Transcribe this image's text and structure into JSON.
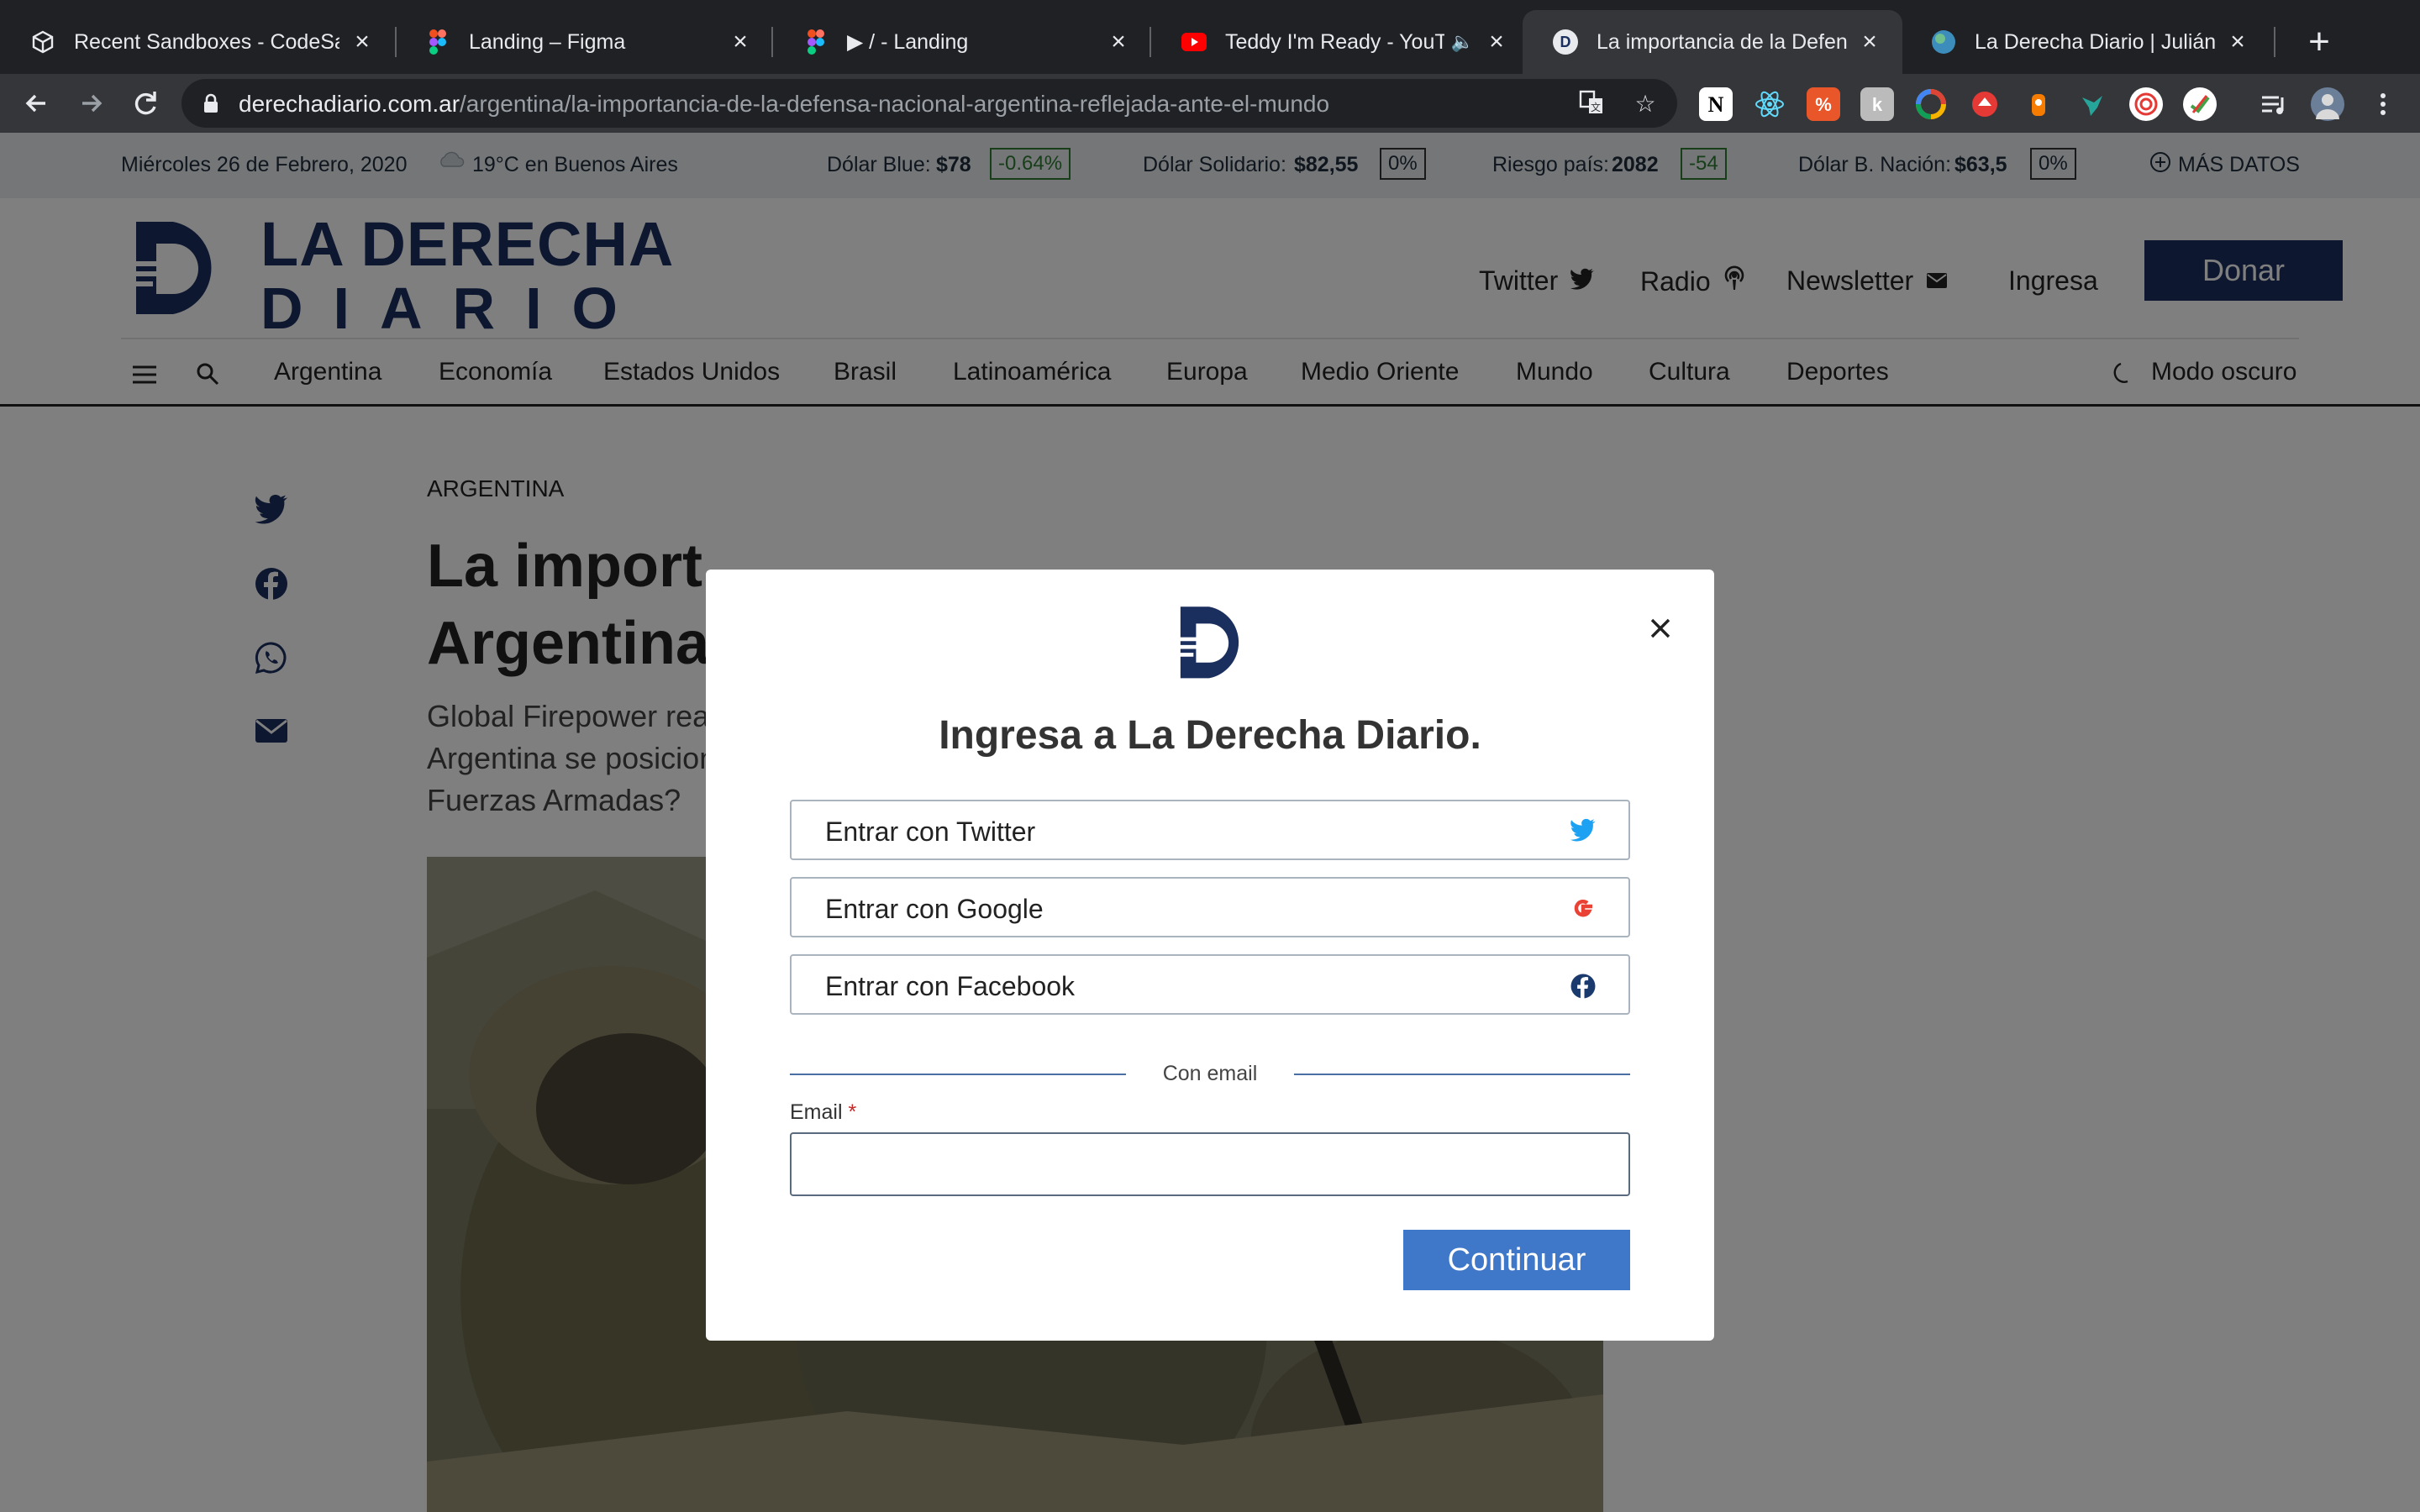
{
  "browser": {
    "tabs": [
      {
        "title": "Recent Sandboxes - CodeSandbox",
        "icon": "codesandbox-icon"
      },
      {
        "title": "Landing – Figma",
        "icon": "figma-icon"
      },
      {
        "title": "▶︎ / - Landing",
        "icon": "figma-icon"
      },
      {
        "title": "Teddy I'm Ready - YouTube",
        "icon": "youtube-icon"
      },
      {
        "title": "La importancia de la Defensa",
        "icon": "derecha-diario-icon"
      },
      {
        "title": "La Derecha Diario | Julián Ben",
        "icon": "globe-icon"
      }
    ],
    "new_tab": "+",
    "url_host": "derechadiario.com.ar",
    "url_path": "/argentina/la-importancia-de-la-defensa-nacional-argentina-reflejada-ante-el-mundo"
  },
  "ticker": {
    "date": "Miércoles 26 de Febrero, 2020",
    "weather": "19°C en Buenos Aires",
    "dolar_blue_label": "Dólar Blue:",
    "dolar_blue_value": "$78",
    "dolar_blue_change": "-0.64%",
    "dolar_solidario_label": "Dólar Solidario:",
    "dolar_solidario_value": "$82,55",
    "dolar_solidario_change": "0%",
    "riesgo_label": "Riesgo país:",
    "riesgo_value": "2082",
    "riesgo_change": "-54",
    "dolar_nacion_label": "Dólar B. Nación:",
    "dolar_nacion_value": "$63,5",
    "dolar_nacion_change": "0%",
    "more": "MÁS DATOS"
  },
  "header": {
    "logo_line1": "LA DERECHA",
    "logo_line2": "DIARIO",
    "twitter": "Twitter",
    "radio": "Radio",
    "newsletter": "Newsletter",
    "login": "Ingresa",
    "donate": "Donar"
  },
  "nav": {
    "items": [
      "Argentina",
      "Economía",
      "Estados Unidos",
      "Brasil",
      "Latinoamérica",
      "Europa",
      "Medio Oriente",
      "Mundo",
      "Cultura",
      "Deportes"
    ],
    "dark_mode": "Modo oscuro"
  },
  "article": {
    "category": "ARGENTINA",
    "title_line1": "La import",
    "title_line2": "Argentina",
    "lead_line1": "Global Firepower rea",
    "lead_line2": "Argentina se posicion",
    "lead_line3": "Fuerzas Armadas?"
  },
  "modal": {
    "title": "Ingresa a La Derecha Diario.",
    "twitter_btn": "Entrar con Twitter",
    "google_btn": "Entrar con Google",
    "facebook_btn": "Entrar con Facebook",
    "divider": "Con email",
    "email_label": "Email",
    "required_mark": "*",
    "email_value": "",
    "continue": "Continuar"
  },
  "colors": {
    "brand_navy": "#1a2f5e",
    "continue_blue": "#3f78c9",
    "twitter_blue": "#1da1f2",
    "google_red": "#ea4335",
    "facebook_blue": "#1877f2"
  }
}
